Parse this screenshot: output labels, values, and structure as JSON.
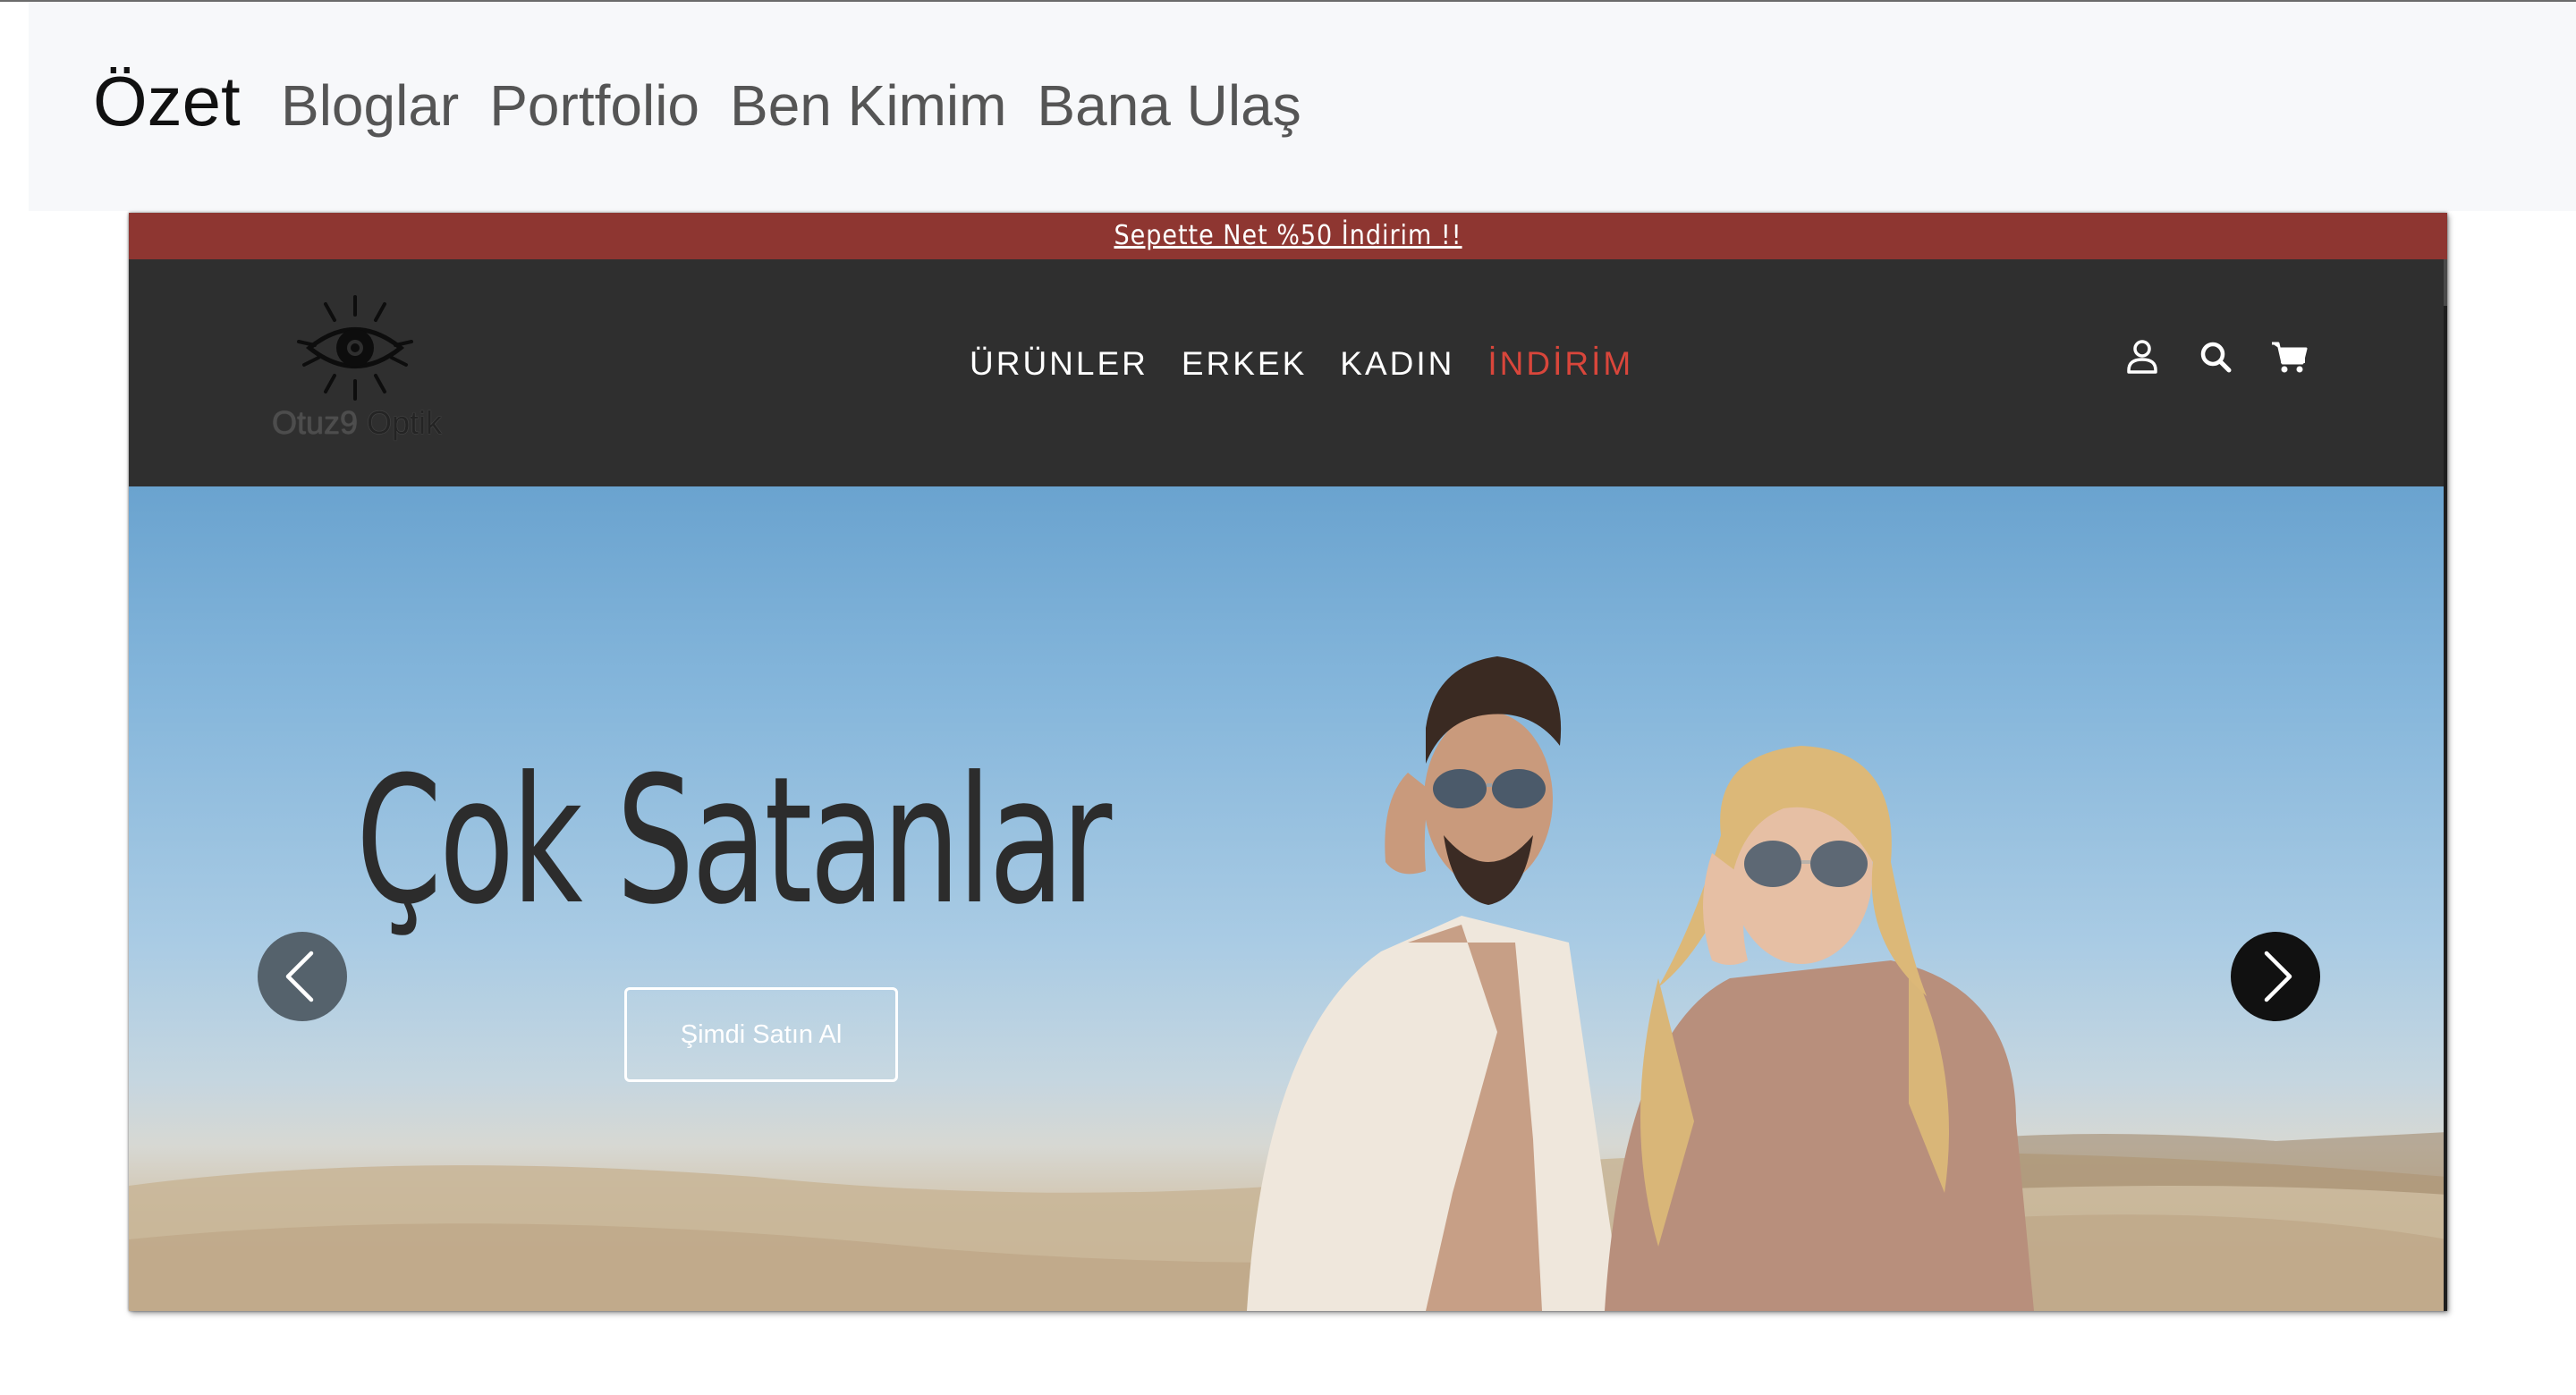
{
  "portfolio_nav": {
    "brand": "Özet",
    "links": [
      "Bloglar",
      "Portfolio",
      "Ben Kimim",
      "Bana Ulaş"
    ]
  },
  "site": {
    "announcement": "Sepette Net %50 İndirim !!",
    "logo": {
      "icon": "eye-icon",
      "text_part1": "Otuz9",
      "text_part2": " Optik"
    },
    "menu": [
      "ÜRÜNLER",
      "ERKEK",
      "KADIN",
      "İNDİRİM"
    ],
    "sale_color": "#d9463b",
    "announcement_color": "#8e3631",
    "header_icons": [
      "user-icon",
      "search-icon",
      "cart-icon"
    ],
    "hero": {
      "title": "Çok Satanlar",
      "button": "Şimdi Satın Al",
      "prev_icon": "chevron-left-icon",
      "next_icon": "chevron-right-icon"
    }
  }
}
